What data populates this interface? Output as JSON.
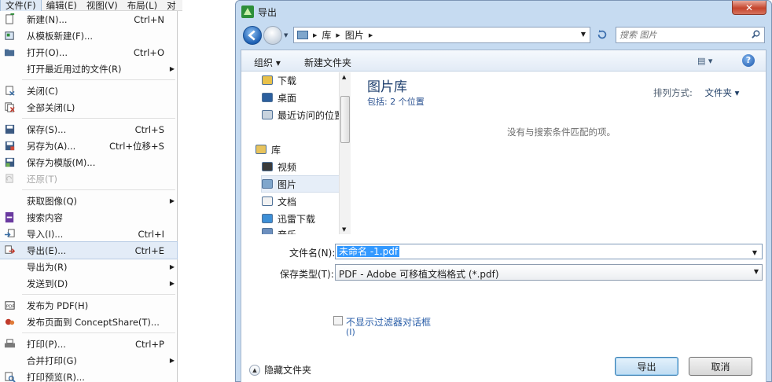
{
  "menubar": [
    "文件(F)",
    "编辑(E)",
    "视图(V)",
    "布局(L)",
    "对"
  ],
  "file_menu": [
    {
      "icon": "new-doc-icon",
      "label": "新建(N)...",
      "shortcut": "Ctrl+N"
    },
    {
      "icon": "template-icon",
      "label": "从模板新建(F)...",
      "shortcut": ""
    },
    {
      "icon": "open-folder-icon",
      "label": "打开(O)...",
      "shortcut": "Ctrl+O"
    },
    {
      "icon": "",
      "label": "打开最近用过的文件(R)",
      "shortcut": "",
      "submenu": true
    },
    {
      "sep": true
    },
    {
      "icon": "close-doc-icon",
      "label": "关闭(C)",
      "shortcut": ""
    },
    {
      "icon": "close-all-icon",
      "label": "全部关闭(L)",
      "shortcut": ""
    },
    {
      "sep": true
    },
    {
      "icon": "save-icon",
      "label": "保存(S)...",
      "shortcut": "Ctrl+S"
    },
    {
      "icon": "save-as-icon",
      "label": "另存为(A)...",
      "shortcut": "Ctrl+位移+S"
    },
    {
      "icon": "save-template-icon",
      "label": "保存为模版(M)...",
      "shortcut": ""
    },
    {
      "icon": "revert-icon",
      "label": "还原(T)",
      "shortcut": "",
      "disabled": true
    },
    {
      "sep": true
    },
    {
      "icon": "",
      "label": "获取图像(Q)",
      "shortcut": "",
      "submenu": true
    },
    {
      "icon": "search-content-icon",
      "label": "搜索内容",
      "shortcut": ""
    },
    {
      "icon": "import-icon",
      "label": "导入(I)...",
      "shortcut": "Ctrl+I"
    },
    {
      "icon": "export-icon",
      "label": "导出(E)...",
      "shortcut": "Ctrl+E",
      "highlight": true
    },
    {
      "icon": "",
      "label": "导出为(R)",
      "shortcut": "",
      "submenu": true
    },
    {
      "icon": "",
      "label": "发送到(D)",
      "shortcut": "",
      "submenu": true
    },
    {
      "sep": true
    },
    {
      "icon": "pdf-icon",
      "label": "发布为 PDF(H)",
      "shortcut": ""
    },
    {
      "icon": "conceptshare-icon",
      "label": "发布页面到 ConceptShare(T)...",
      "shortcut": ""
    },
    {
      "sep": true
    },
    {
      "icon": "print-icon",
      "label": "打印(P)...",
      "shortcut": "Ctrl+P"
    },
    {
      "icon": "",
      "label": "合并打印(G)",
      "shortcut": "",
      "submenu": true
    },
    {
      "icon": "print-preview-icon",
      "label": "打印预览(R)...",
      "shortcut": ""
    }
  ],
  "dialog": {
    "title": "导出",
    "close_glyph": "✕",
    "address": {
      "crumbs": [
        "库",
        "图片"
      ]
    },
    "search_placeholder": "搜索 图片",
    "toolbar": {
      "organize": "组织 ▾",
      "new_folder": "新建文件夹",
      "view_glyph": "▤ ▾",
      "help_glyph": "?"
    },
    "nav": [
      {
        "label": "下载",
        "icon": "downloads-icon",
        "group": false
      },
      {
        "label": "桌面",
        "icon": "desktop-icon",
        "group": false
      },
      {
        "label": "最近访问的位置",
        "icon": "recent-places-icon",
        "group": false
      },
      {
        "label": "库",
        "icon": "library-icon",
        "group": true
      },
      {
        "label": "视频",
        "icon": "videos-icon",
        "group": false
      },
      {
        "label": "图片",
        "icon": "pictures-icon",
        "group": false,
        "selected": true
      },
      {
        "label": "文档",
        "icon": "documents-icon",
        "group": false
      },
      {
        "label": "迅雷下载",
        "icon": "thunder-download-icon",
        "group": false
      },
      {
        "label": "音乐",
        "icon": "music-icon",
        "group": false
      }
    ],
    "library_title": "图片库",
    "library_sub": "包括: 2 个位置",
    "arrange_label": "排列方式:",
    "arrange_value": "文件夹 ▾",
    "empty_message": "没有与搜索条件匹配的项。",
    "filename_label": "文件名(N):",
    "filename_value": "未命名 -1.pdf",
    "filetype_label": "保存类型(T):",
    "filetype_value": "PDF - Adobe 可移植文档格式 (*.pdf)",
    "nofilter_label": "不显示过滤器对话框",
    "nofilter_accel": "(I)",
    "hide_folders": "隐藏文件夹",
    "export_button": "导出",
    "cancel_button": "取消"
  }
}
